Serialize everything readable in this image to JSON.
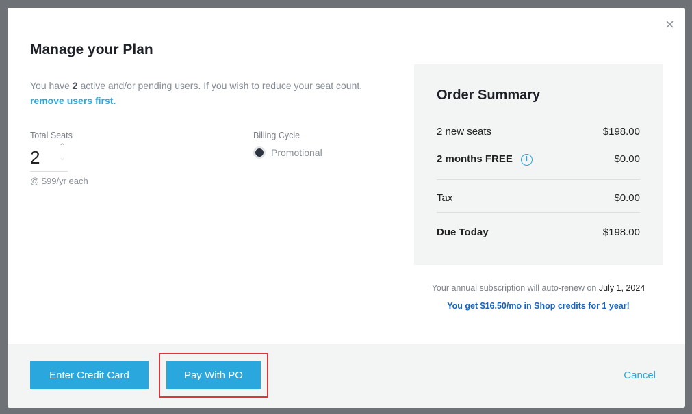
{
  "modal": {
    "title": "Manage your Plan",
    "close_icon": "×"
  },
  "intro": {
    "prefix": "You have ",
    "count": "2",
    "suffix": " active and/or pending users. If you wish to reduce your seat count, ",
    "link": "remove users first."
  },
  "seats": {
    "label": "Total Seats",
    "value": "2",
    "price": "@ $99/yr each"
  },
  "billing": {
    "label": "Billing Cycle",
    "option": "Promotional",
    "selected": true
  },
  "summary": {
    "title": "Order Summary",
    "rows": [
      {
        "label": "2 new seats",
        "value": "$198.00"
      },
      {
        "label": "2 months FREE",
        "value": "$0.00"
      },
      {
        "label": "Tax",
        "value": "$0.00"
      },
      {
        "label": "Due Today",
        "value": "$198.00"
      }
    ]
  },
  "renew": {
    "text": "Your annual subscription will auto-renew on ",
    "date": "July 1, 2024"
  },
  "credit": "You get $16.50/mo in Shop credits for 1 year!",
  "footer": {
    "credit_card": "Enter Credit Card",
    "po": "Pay With PO",
    "cancel": "Cancel"
  },
  "colors": {
    "accent": "#2aa7dc",
    "highlight": "#d8383c",
    "credit": "#1565c0"
  }
}
